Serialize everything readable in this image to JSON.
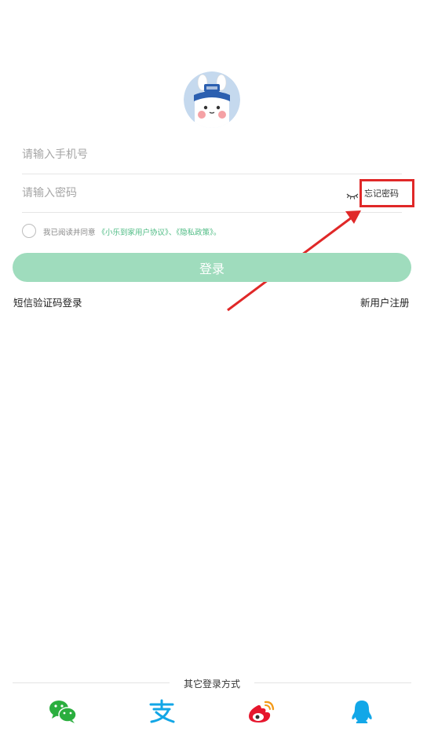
{
  "login": {
    "phone_placeholder": "请输入手机号",
    "password_placeholder": "请输入密码",
    "forgot_password": "忘记密码",
    "agreement_prefix": "我已阅读并同意",
    "agreement_user": "《小乐到家用户协议》",
    "agreement_separator": "、",
    "agreement_privacy": "《隐私政策》",
    "agreement_suffix": "。",
    "login_button": "登录",
    "sms_login": "短信验证码登录",
    "register": "新用户注册"
  },
  "other_login": {
    "title": "其它登录方式",
    "methods": [
      "wechat",
      "alipay",
      "weibo",
      "qq"
    ]
  },
  "colors": {
    "accent_green": "#4dbb83",
    "button_disabled": "#9fdcbd",
    "annotation_red": "#e02828",
    "wechat": "#2aae3e",
    "alipay": "#12a6e6",
    "weibo": "#e6162d",
    "qq": "#12a7e8"
  }
}
